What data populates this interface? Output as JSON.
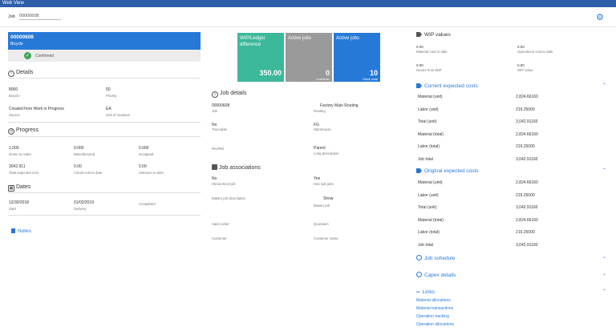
{
  "window": {
    "title": "Web View"
  },
  "jobbar": {
    "label": "Job",
    "value": "00000608"
  },
  "header": {
    "job_number": "00000608",
    "job_desc": "Bicycle",
    "status": "Confirmed"
  },
  "details": {
    "title": "Details",
    "item_value": "8000",
    "item_label": "Bicycle",
    "priority_value": "50",
    "priority_label": "Priority",
    "source_value": "Created from Work in Progress",
    "source_label": "Source",
    "uom_value": "EA",
    "uom_label": "Unit of measure"
  },
  "progress": {
    "title": "Progress",
    "gross_value": "1,000",
    "gross_label": "Gross to make",
    "manufactured_value": "0.000",
    "manufactured_label": "Manufactured",
    "scrapped_value": "0.000",
    "scrapped_label": "Scrapped",
    "total_expected_value": "3042.911",
    "total_expected_label": "Total expected cost",
    "actual_value": "0.00",
    "actual_label": "Actual cost to date",
    "variance_value": "0.00",
    "variance_label": "Variance to date"
  },
  "dates": {
    "title": "Dates",
    "start_value": "12/30/2018",
    "start_label": "Start",
    "delivery_value": "01/02/2019",
    "delivery_label": "Delivery",
    "completed_label": "Completed"
  },
  "notes": {
    "label": "Notes"
  },
  "tiles": [
    {
      "title": "WIP/Ledger difference",
      "value": "350.00",
      "sub": "",
      "color": "#3cb89a"
    },
    {
      "title": "Active jobs",
      "value": "0",
      "sub": "Customer",
      "color": "#9a9a9a"
    },
    {
      "title": "Active jobs",
      "value": "10",
      "sub": "Stock code",
      "color": "#2779d8"
    }
  ],
  "job_details": {
    "title": "Job details",
    "job_value": "00000608",
    "job_label": "Job",
    "routing_value": "Factory Main Routing",
    "routing_label": "Routing",
    "traceable_value": "No",
    "traceable_label": "Traceable",
    "warehouse_value": "FG",
    "warehouse_label": "Warehouse",
    "revrel_label": "Rev/Rel",
    "parent_value": "Parent",
    "longdesc_label": "Long description"
  },
  "job_assoc": {
    "title": "Job associations",
    "hier_value": "No",
    "hier_label": "Hierarchical job",
    "subjobs_value": "Yes",
    "subjobs_label": "Has sub jobs",
    "master_desc_label": "Master job description",
    "show_label": "Show",
    "master_label": "Master job",
    "sales_order_label": "Sales order",
    "quotation_label": "Quotation",
    "customer_label": "Customer",
    "customer_name_label": "Customer name"
  },
  "wip": {
    "title": "WIP values",
    "mat_value": "0.00",
    "mat_label": "Material cost to date",
    "ops_value": "0.00",
    "ops_label": "Operations cost to date",
    "issues_value": "0.00",
    "issues_label": "Issues from WIP",
    "wipv_value": "0.00",
    "wipv_label": "WIP value"
  },
  "current_costs": {
    "title": "Current expected costs",
    "rows": [
      {
        "label": "Material (unit)",
        "value": "2,824.66160"
      },
      {
        "label": "Labor (unit)",
        "value": "219.25000"
      },
      {
        "label": "Total (unit)",
        "value": "3,042.91160"
      },
      {
        "label": "Material (total)",
        "value": "2,824.66160"
      },
      {
        "label": "Labor (total)",
        "value": "219.25000"
      },
      {
        "label": "Job total",
        "value": "3,042.91160"
      }
    ]
  },
  "original_costs": {
    "title": "Original expected costs",
    "rows": [
      {
        "label": "Material (unit)",
        "value": "2,824.66160"
      },
      {
        "label": "Labor (unit)",
        "value": "219.25000"
      },
      {
        "label": "Total (unit)",
        "value": "3,042.91160"
      },
      {
        "label": "Material (total)",
        "value": "2,824.66160"
      },
      {
        "label": "Labor (total)",
        "value": "219.25000"
      },
      {
        "label": "Job total",
        "value": "3,042.91160"
      }
    ]
  },
  "job_schedule": {
    "title": "Job schedule"
  },
  "capex": {
    "title": "Capex details"
  },
  "links": {
    "title": "Links",
    "items": [
      "Material allocations",
      "Material transactions",
      "Operation tracking",
      "Operation allocations"
    ]
  }
}
